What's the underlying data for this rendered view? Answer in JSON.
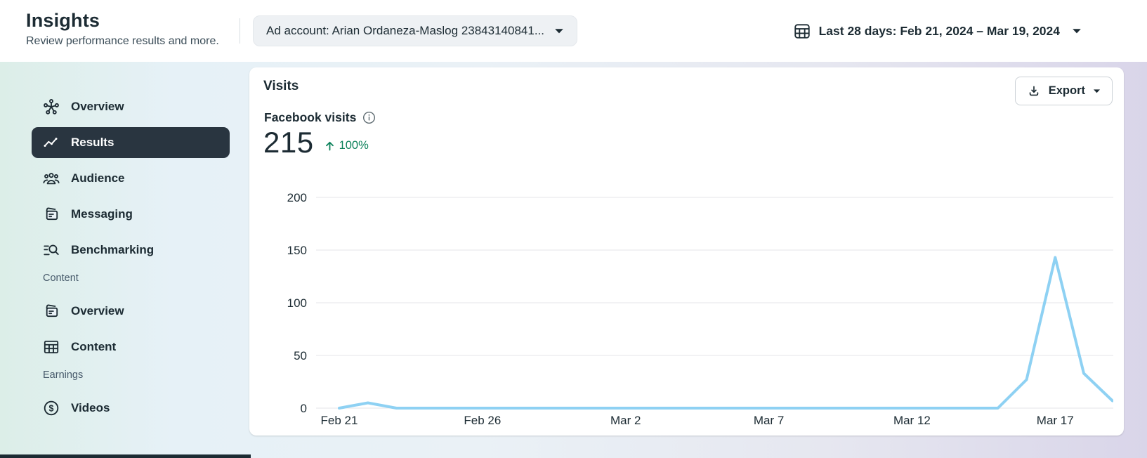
{
  "header": {
    "title": "Insights",
    "subtitle": "Review performance results and more.",
    "ad_account_label": "Ad account: Arian Ordaneza-Maslog 23843140841...",
    "date_range_label": "Last 28 days: Feb 21, 2024 – Mar 19, 2024"
  },
  "sidebar": {
    "items": [
      {
        "label": "Overview",
        "icon": "network-icon",
        "selected": false
      },
      {
        "label": "Results",
        "icon": "trend-icon",
        "selected": true
      },
      {
        "label": "Audience",
        "icon": "people-icon",
        "selected": false
      },
      {
        "label": "Messaging",
        "icon": "messages-icon",
        "selected": false
      },
      {
        "label": "Benchmarking",
        "icon": "benchmark-search-icon",
        "selected": false
      }
    ],
    "sections": [
      {
        "label": "Content",
        "items": [
          {
            "label": "Overview",
            "icon": "cards-icon",
            "selected": false
          },
          {
            "label": "Content",
            "icon": "table-icon",
            "selected": false
          }
        ]
      },
      {
        "label": "Earnings",
        "items": [
          {
            "label": "Videos",
            "icon": "dollar-icon",
            "selected": false
          }
        ]
      }
    ]
  },
  "main": {
    "card_title": "Visits",
    "export_label": "Export",
    "metric": {
      "label": "Facebook visits",
      "value": "215",
      "change": "100%",
      "change_direction": "up"
    },
    "colors": {
      "line": "#8ed1f3",
      "positive": "#0b815a",
      "selected_pill": "#293540",
      "gridline": "#e4e6e9",
      "tick_text": "#1c2b33"
    }
  },
  "chart_data": {
    "type": "line",
    "title": "Facebook visits",
    "x": [
      "Feb 21",
      "Feb 22",
      "Feb 23",
      "Feb 24",
      "Feb 25",
      "Feb 26",
      "Feb 27",
      "Feb 28",
      "Feb 29",
      "Mar 1",
      "Mar 2",
      "Mar 3",
      "Mar 4",
      "Mar 5",
      "Mar 6",
      "Mar 7",
      "Mar 8",
      "Mar 9",
      "Mar 10",
      "Mar 11",
      "Mar 12",
      "Mar 13",
      "Mar 14",
      "Mar 15",
      "Mar 16",
      "Mar 17",
      "Mar 18",
      "Mar 19"
    ],
    "values": [
      0,
      5,
      0,
      0,
      0,
      0,
      0,
      0,
      0,
      0,
      0,
      0,
      0,
      0,
      0,
      0,
      0,
      0,
      0,
      0,
      0,
      0,
      0,
      0,
      27,
      143,
      33,
      7
    ],
    "total": 215,
    "xtick_labels": [
      "Feb 21",
      "Feb 26",
      "Mar 2",
      "Mar 7",
      "Mar 12",
      "Mar 17"
    ],
    "xtick_positions": [
      0,
      5,
      10,
      15,
      20,
      25
    ],
    "ytick_values": [
      0,
      50,
      100,
      150,
      200
    ],
    "ylim": [
      0,
      200
    ],
    "grid": true,
    "legend": "none"
  }
}
